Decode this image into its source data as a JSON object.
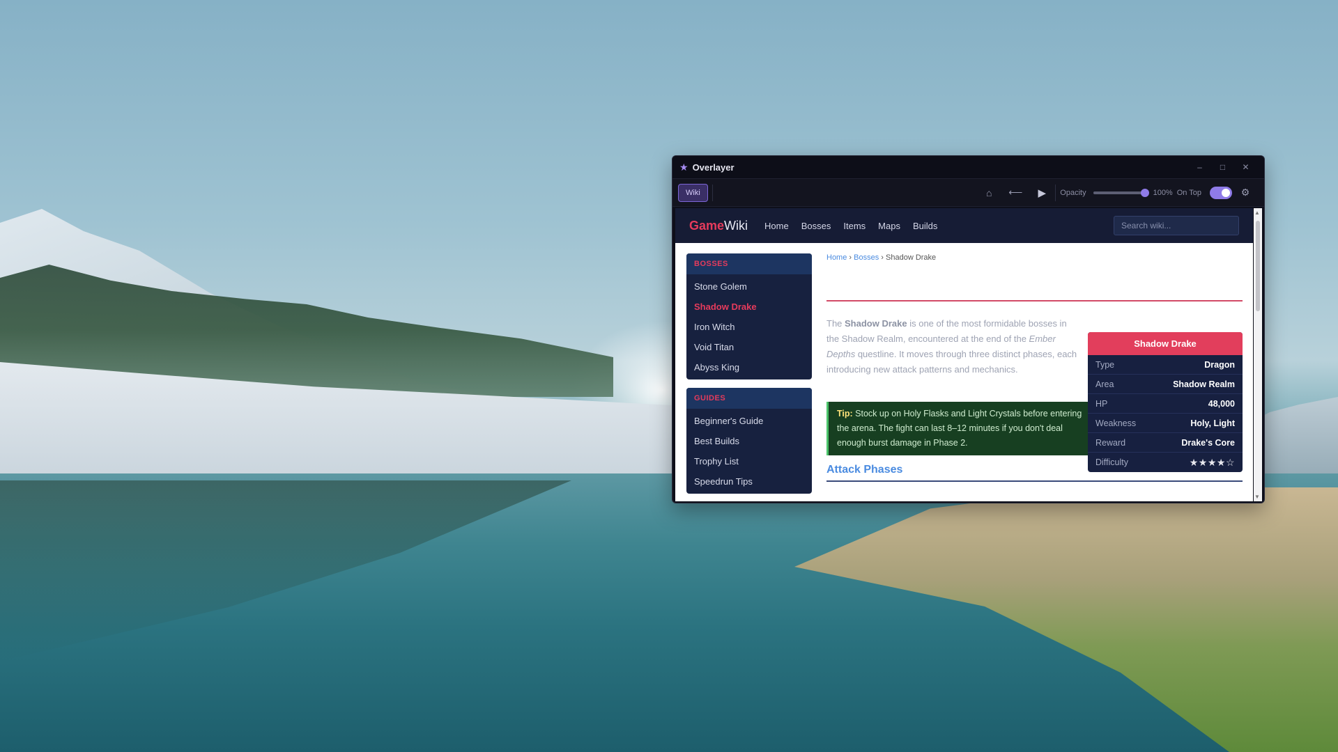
{
  "window": {
    "title": "Overlayer",
    "minimize": "–",
    "maximize": "□",
    "close": "✕"
  },
  "toolbar": {
    "wiki_label": "Wiki",
    "opacity_label": "Opacity",
    "opacity_value": 1.0,
    "opacity_text": "100%",
    "on_top_label": "On Top",
    "on_top_enabled": true,
    "home_icon": "home-icon",
    "back_icon": "back-arrow-icon",
    "play_icon": "play-icon",
    "settings_icon": "gear-icon"
  },
  "wiki": {
    "logo_game": "Game",
    "logo_wiki": "Wiki",
    "nav": [
      "Home",
      "Bosses",
      "Items",
      "Maps",
      "Builds"
    ],
    "search_placeholder": "Search wiki..."
  },
  "sidebar": {
    "bosses_heading": "BOSSES",
    "bosses": [
      "Stone Golem",
      "Shadow Drake",
      "Iron Witch",
      "Void Titan",
      "Abyss King"
    ],
    "active_boss": "Shadow Drake",
    "guides_heading": "GUIDES",
    "guides": [
      "Beginner's Guide",
      "Best Builds",
      "Trophy List",
      "Speedrun Tips"
    ]
  },
  "breadcrumb": {
    "home": "Home",
    "sep1": "›",
    "bosses": "Bosses",
    "sep2": "›",
    "current": "Shadow Drake"
  },
  "article": {
    "intro_1": "The ",
    "intro_name": "Shadow Drake",
    "intro_2": " is one of the most formidable bosses in the Shadow Realm, encountered at the end of the ",
    "intro_quest": "Ember Depths",
    "intro_3": " questline. It moves through three distinct phases, each introducing new attack patterns and mechanics.",
    "tip_label": "Tip:",
    "tip_text": " Stock up on Holy Flasks and Light Crystals before entering the arena. The fight can last 8–12 minutes if you don't deal enough burst damage in Phase 2.",
    "section_title": "Attack Phases"
  },
  "infobox": {
    "title": "Shadow Drake",
    "rows": [
      {
        "key": "Type",
        "value": "Dragon"
      },
      {
        "key": "Area",
        "value": "Shadow Realm"
      },
      {
        "key": "HP",
        "value": "48,000"
      },
      {
        "key": "Weakness",
        "value": "Holy, Light"
      },
      {
        "key": "Reward",
        "value": "Drake's Core"
      }
    ],
    "difficulty_key": "Difficulty",
    "difficulty_stars": "★★★★☆",
    "difficulty_rating": 4
  },
  "colors": {
    "accent": "#8f7be8",
    "brand": "#e63b5c",
    "link": "#4a8be0",
    "tip_bg": "#173f21"
  }
}
